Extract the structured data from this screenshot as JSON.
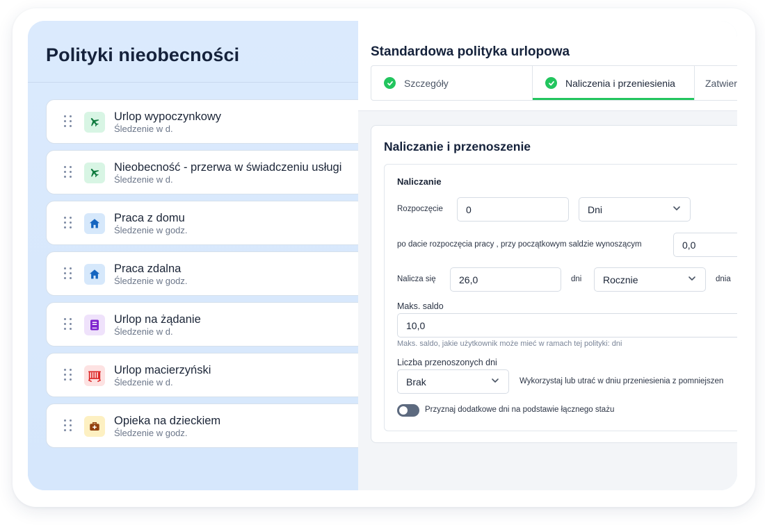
{
  "left_panel": {
    "title": "Polityki nieobecności",
    "policies": [
      {
        "name": "Urlop wypoczynkowy",
        "tracking": "Śledzenie w d.",
        "icon": "airplane-icon",
        "icon_color": "#0f7a3e",
        "icon_bg": "#d8f5e4"
      },
      {
        "name": "Nieobecność - przerwa w świadczeniu usługi",
        "tracking": "Śledzenie w d.",
        "icon": "airplane-icon",
        "icon_color": "#0f7a3e",
        "icon_bg": "#d8f5e4"
      },
      {
        "name": "Praca z domu",
        "tracking": "Śledzenie w godz.",
        "icon": "home-icon",
        "icon_color": "#1565c0",
        "icon_bg": "#d6e8fb"
      },
      {
        "name": "Praca zdalna",
        "tracking": "Śledzenie w godz.",
        "icon": "home-icon",
        "icon_color": "#1565c0",
        "icon_bg": "#d6e8fb"
      },
      {
        "name": "Urlop na żądanie",
        "tracking": "Śledzenie w d.",
        "icon": "book-icon",
        "icon_color": "#7e22ce",
        "icon_bg": "#efe2fb"
      },
      {
        "name": "Urlop macierzyński",
        "tracking": "Śledzenie w d.",
        "icon": "crib-icon",
        "icon_color": "#dc2626",
        "icon_bg": "#fde2e2"
      },
      {
        "name": "Opieka na dzieckiem",
        "tracking": "Śledzenie w godz.",
        "icon": "medical-kit-icon",
        "icon_color": "#92400e",
        "icon_bg": "#fdf0c2"
      }
    ]
  },
  "right_panel": {
    "title": "Standardowa polityka urlopowa",
    "tabs": [
      {
        "label": "Szczegóły",
        "completed": true,
        "active": false
      },
      {
        "label": "Naliczenia i przeniesienia",
        "completed": true,
        "active": true
      },
      {
        "label": "Zatwier",
        "completed": false,
        "active": false
      }
    ],
    "section": {
      "title": "Naliczanie i przenoszenie",
      "accrual_heading": "Naliczanie",
      "start_label": "Rozpoczęcie",
      "start_value": "0",
      "start_unit": "Dni",
      "after_start_label": "po dacie rozpoczęcia pracy , przy początkowym saldzie wynoszącym",
      "initial_balance": "0,0",
      "accrues_label": "Nalicza się",
      "accrues_value": "26,0",
      "days_label": "dni",
      "frequency": "Rocznie",
      "day_label": "dnia",
      "max_balance_label": "Maks. saldo",
      "max_balance_value": "10,0",
      "max_balance_hint": "Maks. saldo, jakie użytkownik może mieć w ramach tej polityki: dni",
      "carryover_label": "Liczba przenoszonych dni",
      "carryover_value": "Brak",
      "carryover_hint": "Wykorzystaj lub utrać w dniu przeniesienia z pomniejszen",
      "seniority_toggle_label": "Przyznaj dodatkowe dni na podstawie łącznego stażu",
      "seniority_toggle_on": false
    }
  },
  "colors": {
    "accent_green": "#22c55e",
    "left_bg": "#dbeafd",
    "heading": "#15223b"
  }
}
